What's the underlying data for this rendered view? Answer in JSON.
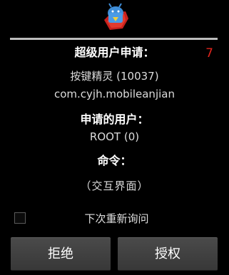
{
  "dialog": {
    "request_title": "超级用户申请：",
    "countdown": "7",
    "app_name": "按键精灵 (10037)",
    "package_name": "com.cyjh.mobileanjian",
    "user_title": "申请的用户：",
    "user_value": "ROOT (0)",
    "command_title": "命令：",
    "command_value": "（交互界面）",
    "remember_label": "下次重新询问",
    "remember_checked": false,
    "deny_label": "拒绝",
    "grant_label": "授权"
  },
  "icons": {
    "app_icon": "superuser-android-icon"
  },
  "colors": {
    "background": "#000000",
    "countdown": "#e0241c",
    "divider": "#bdbdbd",
    "button": "#404040"
  }
}
